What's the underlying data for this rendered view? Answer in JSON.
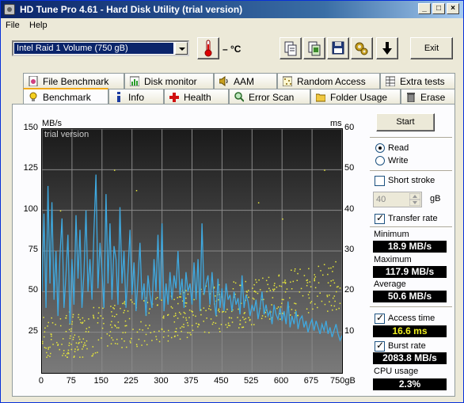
{
  "window": {
    "title": "HD Tune Pro 4.61 - Hard Disk Utility (trial version)",
    "controls": {
      "minimize": "_",
      "maximize": "□",
      "close": "×"
    }
  },
  "menu": {
    "file": "File",
    "help": "Help"
  },
  "toolbar": {
    "drive": "Intel   Raid 1 Volume (750 gB)",
    "temperature": "– °C",
    "exit_label": "Exit"
  },
  "tabs_top": [
    "File Benchmark",
    "Disk monitor",
    "AAM",
    "Random Access",
    "Extra tests"
  ],
  "tabs_bottom": [
    "Benchmark",
    "Info",
    "Health",
    "Error Scan",
    "Folder Usage",
    "Erase"
  ],
  "active_tab": "Benchmark",
  "chart_data": {
    "type": "line",
    "watermark": "trial version",
    "y_left_unit": "MB/s",
    "y_right_unit": "ms",
    "x_unit": "gB",
    "xlim": [
      0,
      750
    ],
    "ylim_left": [
      0,
      150
    ],
    "ylim_right": [
      0,
      60
    ],
    "x_ticks": [
      0,
      75,
      150,
      225,
      300,
      375,
      450,
      525,
      600,
      675,
      750
    ],
    "x_tick_labels": [
      "0",
      "75",
      "150",
      "225",
      "300",
      "375",
      "450",
      "525",
      "600",
      "675",
      "750gB"
    ],
    "y_left_ticks": [
      25,
      50,
      75,
      100,
      125,
      150
    ],
    "y_right_ticks": [
      10,
      20,
      30,
      40,
      50,
      60
    ],
    "grid": true,
    "series": [
      {
        "color": "#3fa9e0",
        "x": [
          0,
          5,
          10,
          15,
          20,
          25,
          30,
          35,
          40,
          45,
          50,
          55,
          60,
          65,
          70,
          75,
          80,
          85,
          90,
          95,
          100,
          105,
          110,
          115,
          120,
          125,
          130,
          135,
          140,
          145,
          150,
          155,
          160,
          165,
          170,
          175,
          180,
          185,
          190,
          195,
          200,
          205,
          210,
          215,
          220,
          225,
          230,
          235,
          240,
          245,
          250,
          255,
          260,
          265,
          270,
          275,
          280,
          285,
          290,
          295,
          300,
          305,
          310,
          315,
          320,
          325,
          330,
          335,
          340,
          345,
          350,
          355,
          360,
          365,
          370,
          375,
          380,
          385,
          390,
          395,
          400,
          405,
          410,
          415,
          420,
          425,
          430,
          435,
          440,
          445,
          450,
          455,
          460,
          465,
          470,
          475,
          480,
          485,
          490,
          495,
          500,
          505,
          510,
          515,
          520,
          525,
          530,
          535,
          540,
          545,
          550,
          555,
          560,
          565,
          570,
          575,
          580,
          585,
          590,
          595,
          600,
          605,
          610,
          615,
          620,
          625,
          630,
          635,
          640,
          645,
          650,
          655,
          660,
          665,
          670,
          675,
          680,
          685,
          690,
          695,
          700,
          705,
          710,
          715,
          720,
          725,
          730,
          735,
          740,
          745,
          750
        ],
        "y": [
          50,
          98,
          40,
          115,
          55,
          105,
          45,
          75,
          35,
          72,
          95,
          40,
          60,
          85,
          30,
          70,
          42,
          97,
          58,
          88,
          40,
          62,
          100,
          50,
          70,
          45,
          88,
          122,
          52,
          80,
          62,
          40,
          110,
          55,
          92,
          45,
          78,
          70,
          42,
          102,
          55,
          75,
          40,
          62,
          88,
          48,
          68,
          38,
          58,
          80,
          45,
          55,
          35,
          60,
          48,
          40,
          70,
          50,
          85,
          45,
          92,
          38,
          55,
          42,
          62,
          45,
          60,
          52,
          75,
          48,
          58,
          40,
          62,
          50,
          55,
          42,
          68,
          45,
          70,
          38,
          92,
          48,
          55,
          60,
          42,
          62,
          45,
          35,
          58,
          40,
          52,
          38,
          55,
          45,
          48,
          38,
          50,
          42,
          46,
          36,
          60,
          40,
          48,
          44,
          35,
          42,
          38,
          45,
          33,
          40,
          50,
          36,
          42,
          35,
          38,
          30,
          42,
          36,
          33,
          40,
          32,
          38,
          30,
          44,
          28,
          35,
          30,
          38,
          27,
          33,
          35,
          28,
          32,
          25,
          30,
          33,
          26,
          32,
          28,
          24,
          30,
          26,
          32,
          24,
          28,
          22,
          26,
          30,
          24,
          20,
          23
        ]
      }
    ],
    "scatter": {
      "color": "#e8e83a",
      "seed_note": "",
      "x_range": [
        0,
        750
      ],
      "y_range_ms": [
        4,
        30
      ]
    }
  },
  "right_panel": {
    "start_label": "Start",
    "read_label": "Read",
    "write_label": "Write",
    "short_stroke_label": "Short stroke",
    "short_stroke_value": "40",
    "gb_label": "gB",
    "transfer_rate_label": "Transfer rate",
    "minimum_label": "Minimum",
    "minimum_value": "18.9 MB/s",
    "maximum_label": "Maximum",
    "maximum_value": "117.9 MB/s",
    "average_label": "Average",
    "average_value": "50.6 MB/s",
    "access_time_label": "Access time",
    "access_time_value": "16.6 ms",
    "burst_rate_label": "Burst rate",
    "burst_rate_value": "2083.8 MB/s",
    "cpu_usage_label": "CPU usage",
    "cpu_usage_value": "2.3%",
    "read_selected": true,
    "short_stroke_checked": false,
    "transfer_rate_checked": true,
    "access_time_checked": true,
    "burst_rate_checked": true
  }
}
